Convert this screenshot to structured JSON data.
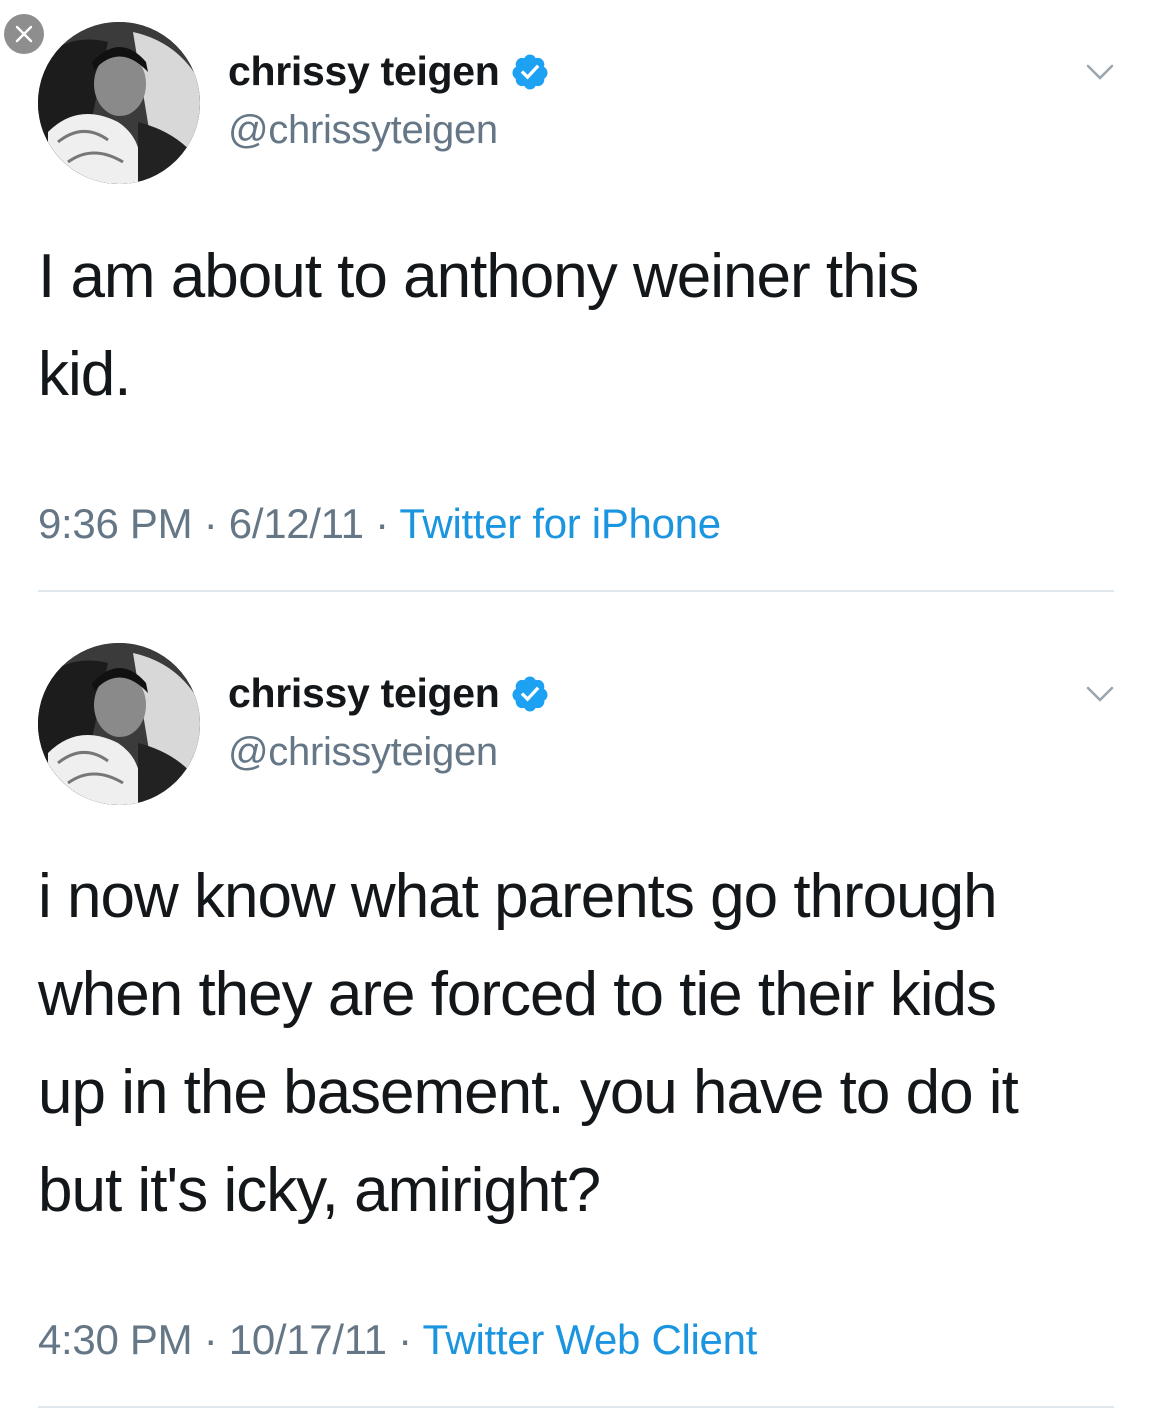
{
  "close_icon": "close-icon",
  "colors": {
    "name": "#14171a",
    "secondary": "#657786",
    "link": "#1b95e0",
    "verified": "#1da1f2",
    "divider": "#e1e8ed"
  },
  "tweets": [
    {
      "display_name": "chrissy teigen",
      "handle": "@chrissyteigen",
      "verified": true,
      "text_lines": [
        "I am about to anthony weiner this",
        "kid."
      ],
      "time": "9:36 PM",
      "date": "6/12/11",
      "source": "Twitter for iPhone",
      "separator": "·"
    },
    {
      "display_name": "chrissy teigen",
      "handle": "@chrissyteigen",
      "verified": true,
      "text_lines": [
        "i now know what parents go through",
        "when they are forced to tie their kids",
        "up in the basement. you have to do it",
        "but it's icky, amiright?"
      ],
      "time": "4:30 PM",
      "date": "10/17/11",
      "source": "Twitter Web Client",
      "separator": "·"
    }
  ]
}
